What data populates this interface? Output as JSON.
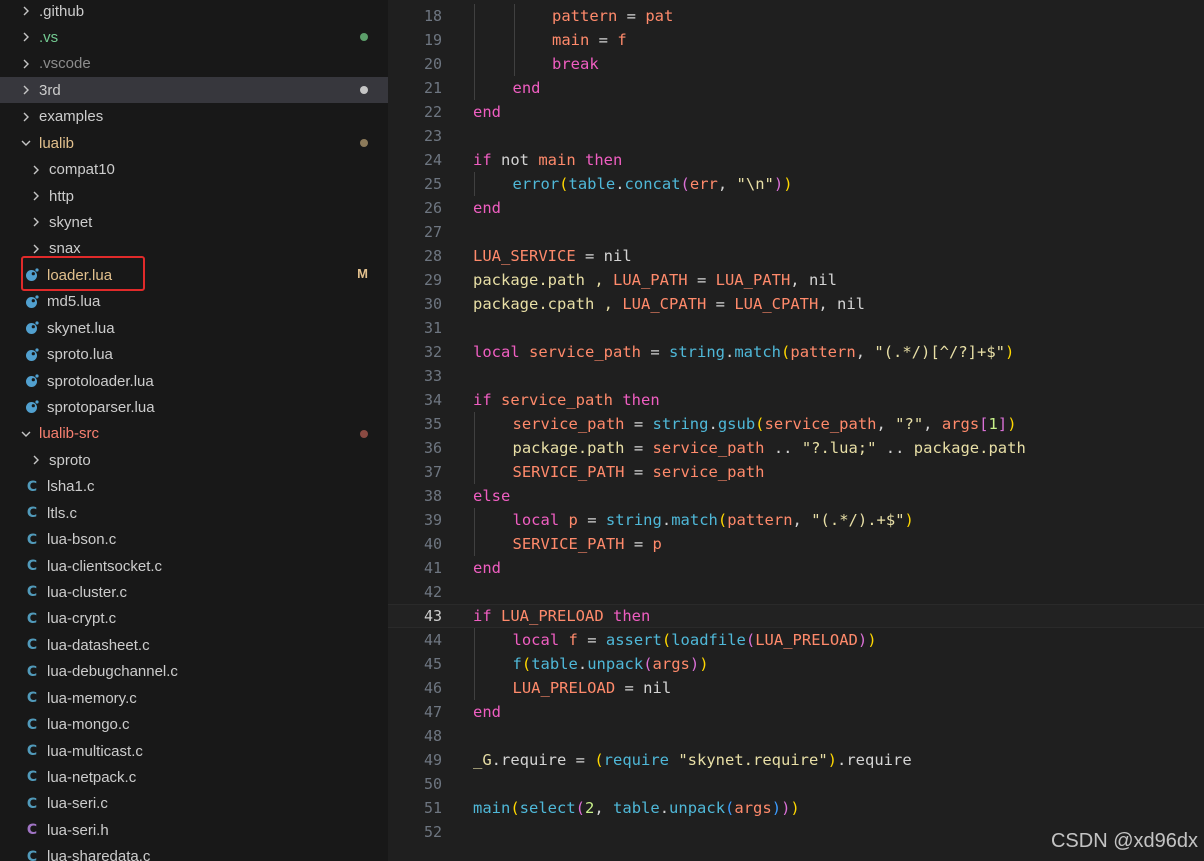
{
  "colors": {
    "sidebar_bg": "#181818",
    "editor_bg": "#1f1f1f",
    "folder_text": "#cccccc",
    "modified_text": "#e2c08d",
    "untracked_text": "#73c991",
    "error_text": "#f88070",
    "ignored_text": "#8c8c8c",
    "highlight_border": "#e02a2a",
    "keyword": "#ef5ec1",
    "variable": "#ff8a6b",
    "func": "#4fb8d8",
    "string": "#e8dfa6",
    "number": "#c7f08a",
    "plain": "#d4d4d4",
    "bracket_gold": "#ffd700",
    "bracket_pink": "#da70d6",
    "bracket_blue": "#3c9cff"
  },
  "sidebar": {
    "items": [
      {
        "name": "folder-github",
        "label": ".github",
        "kind": "folder",
        "level": 0,
        "color": "#cccccc"
      },
      {
        "name": "folder-vs",
        "label": ".vs",
        "kind": "folder",
        "level": 0,
        "color": "#73c991",
        "dot": "#5c9e6a"
      },
      {
        "name": "folder-vscode",
        "label": ".vscode",
        "kind": "folder",
        "level": 0,
        "color": "#8c8c8c"
      },
      {
        "name": "folder-3rd",
        "label": "3rd",
        "kind": "folder",
        "level": 0,
        "color": "#cccccc",
        "dot": "#c5c5c5",
        "active": true
      },
      {
        "name": "folder-examples",
        "label": "examples",
        "kind": "folder",
        "level": 0,
        "color": "#cccccc"
      },
      {
        "name": "folder-lualib",
        "label": "lualib",
        "kind": "folder-open",
        "level": 0,
        "color": "#e2c08d",
        "dot": "#8c7a5a"
      },
      {
        "name": "folder-compat10",
        "label": "compat10",
        "kind": "folder",
        "level": 1,
        "color": "#cccccc"
      },
      {
        "name": "folder-http",
        "label": "http",
        "kind": "folder",
        "level": 1,
        "color": "#cccccc"
      },
      {
        "name": "folder-skynet",
        "label": "skynet",
        "kind": "folder",
        "level": 1,
        "color": "#cccccc"
      },
      {
        "name": "folder-snax",
        "label": "snax",
        "kind": "folder",
        "level": 1,
        "color": "#cccccc"
      },
      {
        "name": "file-loader-lua",
        "label": "loader.lua",
        "kind": "lua",
        "level": 1,
        "color": "#e2c08d",
        "badge": "M"
      },
      {
        "name": "file-md5-lua",
        "label": "md5.lua",
        "kind": "lua",
        "level": 1,
        "color": "#cccccc"
      },
      {
        "name": "file-skynet-lua",
        "label": "skynet.lua",
        "kind": "lua",
        "level": 1,
        "color": "#cccccc"
      },
      {
        "name": "file-sproto-lua",
        "label": "sproto.lua",
        "kind": "lua",
        "level": 1,
        "color": "#cccccc"
      },
      {
        "name": "file-sprotoloader-lua",
        "label": "sprotoloader.lua",
        "kind": "lua",
        "level": 1,
        "color": "#cccccc"
      },
      {
        "name": "file-sprotoparser-lua",
        "label": "sprotoparser.lua",
        "kind": "lua",
        "level": 1,
        "color": "#cccccc"
      },
      {
        "name": "folder-lualib-src",
        "label": "lualib-src",
        "kind": "folder-open",
        "level": 0,
        "color": "#f88070",
        "dot": "#8a4a42"
      },
      {
        "name": "folder-sproto",
        "label": "sproto",
        "kind": "folder",
        "level": 1,
        "color": "#cccccc"
      },
      {
        "name": "file-lsha1-c",
        "label": "lsha1.c",
        "kind": "c",
        "level": 1,
        "color": "#cccccc"
      },
      {
        "name": "file-ltls-c",
        "label": "ltls.c",
        "kind": "c",
        "level": 1,
        "color": "#cccccc"
      },
      {
        "name": "file-lua-bson-c",
        "label": "lua-bson.c",
        "kind": "c",
        "level": 1,
        "color": "#cccccc"
      },
      {
        "name": "file-lua-clientsocket-c",
        "label": "lua-clientsocket.c",
        "kind": "c",
        "level": 1,
        "color": "#cccccc"
      },
      {
        "name": "file-lua-cluster-c",
        "label": "lua-cluster.c",
        "kind": "c",
        "level": 1,
        "color": "#cccccc"
      },
      {
        "name": "file-lua-crypt-c",
        "label": "lua-crypt.c",
        "kind": "c",
        "level": 1,
        "color": "#cccccc"
      },
      {
        "name": "file-lua-datasheet-c",
        "label": "lua-datasheet.c",
        "kind": "c",
        "level": 1,
        "color": "#cccccc"
      },
      {
        "name": "file-lua-debugchannel-c",
        "label": "lua-debugchannel.c",
        "kind": "c",
        "level": 1,
        "color": "#cccccc"
      },
      {
        "name": "file-lua-memory-c",
        "label": "lua-memory.c",
        "kind": "c",
        "level": 1,
        "color": "#cccccc"
      },
      {
        "name": "file-lua-mongo-c",
        "label": "lua-mongo.c",
        "kind": "c",
        "level": 1,
        "color": "#cccccc"
      },
      {
        "name": "file-lua-multicast-c",
        "label": "lua-multicast.c",
        "kind": "c",
        "level": 1,
        "color": "#cccccc"
      },
      {
        "name": "file-lua-netpack-c",
        "label": "lua-netpack.c",
        "kind": "c",
        "level": 1,
        "color": "#cccccc"
      },
      {
        "name": "file-lua-seri-c",
        "label": "lua-seri.c",
        "kind": "c",
        "level": 1,
        "color": "#cccccc"
      },
      {
        "name": "file-lua-seri-h",
        "label": "lua-seri.h",
        "kind": "h",
        "level": 1,
        "color": "#cccccc"
      },
      {
        "name": "file-lua-sharedata-c",
        "label": "lua-sharedata.c",
        "kind": "c",
        "level": 1,
        "color": "#cccccc"
      }
    ]
  },
  "editor": {
    "current_line": 43,
    "lines": [
      {
        "n": 18,
        "indent": 2,
        "tokens": [
          [
            "pattern",
            "v"
          ],
          [
            " = ",
            "p"
          ],
          [
            "pat",
            "v"
          ]
        ]
      },
      {
        "n": 19,
        "indent": 2,
        "tokens": [
          [
            "main",
            "v"
          ],
          [
            " = ",
            "p"
          ],
          [
            "f",
            "v"
          ]
        ]
      },
      {
        "n": 20,
        "indent": 2,
        "tokens": [
          [
            "break",
            "k"
          ]
        ]
      },
      {
        "n": 21,
        "indent": 1,
        "tokens": [
          [
            "end",
            "k"
          ]
        ]
      },
      {
        "n": 22,
        "indent": 0,
        "tokens": [
          [
            "end",
            "k"
          ]
        ]
      },
      {
        "n": 23,
        "indent": 0,
        "tokens": []
      },
      {
        "n": 24,
        "indent": 0,
        "tokens": [
          [
            "if",
            "k"
          ],
          [
            " not ",
            "p"
          ],
          [
            "main",
            "v"
          ],
          [
            " then",
            "k"
          ]
        ]
      },
      {
        "n": 25,
        "indent": 1,
        "tokens": [
          [
            "error",
            "f"
          ],
          [
            "(",
            "b1"
          ],
          [
            "table",
            "f"
          ],
          [
            ".",
            "p"
          ],
          [
            "concat",
            "f"
          ],
          [
            "(",
            "b2"
          ],
          [
            "err",
            "v"
          ],
          [
            ", ",
            "p"
          ],
          [
            "\"\\n\"",
            "s"
          ],
          [
            ")",
            "b2"
          ],
          [
            ")",
            "b1"
          ]
        ]
      },
      {
        "n": 26,
        "indent": 0,
        "tokens": [
          [
            "end",
            "k"
          ]
        ]
      },
      {
        "n": 27,
        "indent": 0,
        "tokens": []
      },
      {
        "n": 28,
        "indent": 0,
        "tokens": [
          [
            "LUA_SERVICE",
            "v"
          ],
          [
            " = ",
            "p"
          ],
          [
            "nil",
            "p"
          ]
        ]
      },
      {
        "n": 29,
        "indent": 0,
        "tokens": [
          [
            "package",
            "s"
          ],
          [
            ".path , ",
            "s"
          ],
          [
            "LUA_PATH",
            "v"
          ],
          [
            " = ",
            "p"
          ],
          [
            "LUA_PATH",
            "v"
          ],
          [
            ", nil",
            "p"
          ]
        ]
      },
      {
        "n": 30,
        "indent": 0,
        "tokens": [
          [
            "package",
            "s"
          ],
          [
            ".cpath , ",
            "s"
          ],
          [
            "LUA_CPATH",
            "v"
          ],
          [
            " = ",
            "p"
          ],
          [
            "LUA_CPATH",
            "v"
          ],
          [
            ", nil",
            "p"
          ]
        ]
      },
      {
        "n": 31,
        "indent": 0,
        "tokens": []
      },
      {
        "n": 32,
        "indent": 0,
        "tokens": [
          [
            "local",
            "k"
          ],
          [
            " ",
            "p"
          ],
          [
            "service_path",
            "v"
          ],
          [
            " = ",
            "p"
          ],
          [
            "string",
            "f"
          ],
          [
            ".",
            "p"
          ],
          [
            "match",
            "f"
          ],
          [
            "(",
            "b1"
          ],
          [
            "pattern",
            "v"
          ],
          [
            ", ",
            "p"
          ],
          [
            "\"(.*/)[^/?]+$\"",
            "s"
          ],
          [
            ")",
            "b1"
          ]
        ]
      },
      {
        "n": 33,
        "indent": 0,
        "tokens": []
      },
      {
        "n": 34,
        "indent": 0,
        "tokens": [
          [
            "if",
            "k"
          ],
          [
            " ",
            "p"
          ],
          [
            "service_path",
            "v"
          ],
          [
            " then",
            "k"
          ]
        ]
      },
      {
        "n": 35,
        "indent": 1,
        "tokens": [
          [
            "service_path",
            "v"
          ],
          [
            " = ",
            "p"
          ],
          [
            "string",
            "f"
          ],
          [
            ".",
            "p"
          ],
          [
            "gsub",
            "f"
          ],
          [
            "(",
            "b1"
          ],
          [
            "service_path",
            "v"
          ],
          [
            ", ",
            "p"
          ],
          [
            "\"?\"",
            "s"
          ],
          [
            ", ",
            "p"
          ],
          [
            "args",
            "v"
          ],
          [
            "[",
            "b2"
          ],
          [
            "1",
            "n"
          ],
          [
            "]",
            "b2"
          ],
          [
            ")",
            "b1"
          ]
        ]
      },
      {
        "n": 36,
        "indent": 1,
        "tokens": [
          [
            "package",
            "s"
          ],
          [
            ".path",
            "s"
          ],
          [
            " = ",
            "p"
          ],
          [
            "service_path",
            "v"
          ],
          [
            " .. ",
            "p"
          ],
          [
            "\"?.lua;\"",
            "s"
          ],
          [
            " .. ",
            "p"
          ],
          [
            "package",
            "s"
          ],
          [
            ".path",
            "s"
          ]
        ]
      },
      {
        "n": 37,
        "indent": 1,
        "tokens": [
          [
            "SERVICE_PATH",
            "v"
          ],
          [
            " = ",
            "p"
          ],
          [
            "service_path",
            "v"
          ]
        ]
      },
      {
        "n": 38,
        "indent": 0,
        "tokens": [
          [
            "else",
            "k"
          ]
        ]
      },
      {
        "n": 39,
        "indent": 1,
        "tokens": [
          [
            "local",
            "k"
          ],
          [
            " ",
            "p"
          ],
          [
            "p",
            "v"
          ],
          [
            " = ",
            "p"
          ],
          [
            "string",
            "f"
          ],
          [
            ".",
            "p"
          ],
          [
            "match",
            "f"
          ],
          [
            "(",
            "b1"
          ],
          [
            "pattern",
            "v"
          ],
          [
            ", ",
            "p"
          ],
          [
            "\"(.*/).+$\"",
            "s"
          ],
          [
            ")",
            "b1"
          ]
        ]
      },
      {
        "n": 40,
        "indent": 1,
        "tokens": [
          [
            "SERVICE_PATH",
            "v"
          ],
          [
            " = ",
            "p"
          ],
          [
            "p",
            "v"
          ]
        ]
      },
      {
        "n": 41,
        "indent": 0,
        "tokens": [
          [
            "end",
            "k"
          ]
        ]
      },
      {
        "n": 42,
        "indent": 0,
        "tokens": []
      },
      {
        "n": 43,
        "indent": 0,
        "tokens": [
          [
            "if",
            "k"
          ],
          [
            " ",
            "p"
          ],
          [
            "LUA_PRELOAD",
            "v"
          ],
          [
            " then",
            "k"
          ]
        ]
      },
      {
        "n": 44,
        "indent": 1,
        "tokens": [
          [
            "local",
            "k"
          ],
          [
            " ",
            "p"
          ],
          [
            "f",
            "v"
          ],
          [
            " = ",
            "p"
          ],
          [
            "assert",
            "f"
          ],
          [
            "(",
            "b1"
          ],
          [
            "loadfile",
            "f"
          ],
          [
            "(",
            "b2"
          ],
          [
            "LUA_PRELOAD",
            "v"
          ],
          [
            ")",
            "b2"
          ],
          [
            ")",
            "b1"
          ]
        ]
      },
      {
        "n": 45,
        "indent": 1,
        "tokens": [
          [
            "f",
            "f"
          ],
          [
            "(",
            "b1"
          ],
          [
            "table",
            "f"
          ],
          [
            ".",
            "p"
          ],
          [
            "unpack",
            "f"
          ],
          [
            "(",
            "b2"
          ],
          [
            "args",
            "v"
          ],
          [
            ")",
            "b2"
          ],
          [
            ")",
            "b1"
          ]
        ]
      },
      {
        "n": 46,
        "indent": 1,
        "tokens": [
          [
            "LUA_PRELOAD",
            "v"
          ],
          [
            " = ",
            "p"
          ],
          [
            "nil",
            "p"
          ]
        ]
      },
      {
        "n": 47,
        "indent": 0,
        "tokens": [
          [
            "end",
            "k"
          ]
        ]
      },
      {
        "n": 48,
        "indent": 0,
        "tokens": []
      },
      {
        "n": 49,
        "indent": 0,
        "tokens": [
          [
            "_G",
            "s"
          ],
          [
            ".require = ",
            "p"
          ],
          [
            "(",
            "b1"
          ],
          [
            "require",
            "f"
          ],
          [
            " ",
            "p"
          ],
          [
            "\"skynet.require\"",
            "s"
          ],
          [
            ")",
            "b1"
          ],
          [
            ".require",
            "p"
          ]
        ]
      },
      {
        "n": 50,
        "indent": 0,
        "tokens": []
      },
      {
        "n": 51,
        "indent": 0,
        "tokens": [
          [
            "main",
            "f"
          ],
          [
            "(",
            "b1"
          ],
          [
            "select",
            "f"
          ],
          [
            "(",
            "b2"
          ],
          [
            "2",
            "n"
          ],
          [
            ", ",
            "p"
          ],
          [
            "table",
            "f"
          ],
          [
            ".",
            "p"
          ],
          [
            "unpack",
            "f"
          ],
          [
            "(",
            "b3"
          ],
          [
            "args",
            "v"
          ],
          [
            ")",
            "b3"
          ],
          [
            ")",
            "b2"
          ],
          [
            ")",
            "b1"
          ]
        ]
      },
      {
        "n": 52,
        "indent": 0,
        "tokens": []
      }
    ]
  },
  "watermark": "CSDN @xd96dx"
}
